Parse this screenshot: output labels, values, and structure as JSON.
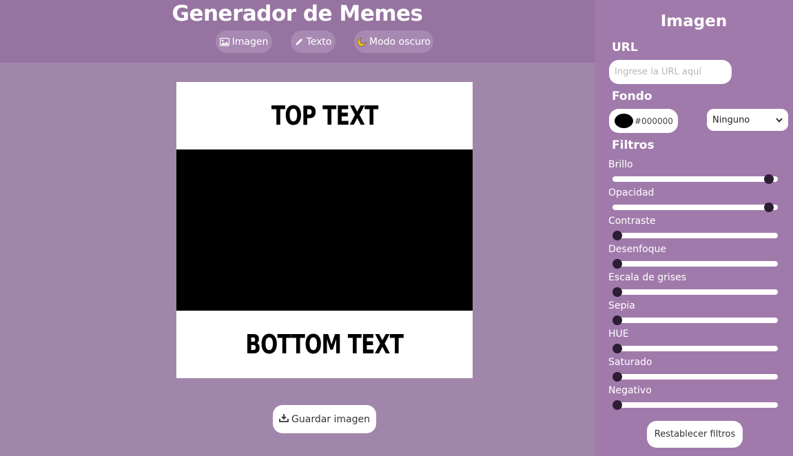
{
  "header": {
    "title": "Generador de Memes",
    "nav": {
      "image_label": "Imagen",
      "text_label": "Texto",
      "dark_mode_label": "Modo oscuro"
    }
  },
  "meme": {
    "top_text": "TOP TEXT",
    "bottom_text": "BOTTOM TEXT",
    "image_background": "#000000"
  },
  "actions": {
    "save_label": "Guardar imagen"
  },
  "panel": {
    "title": "Imagen",
    "url_section": "URL",
    "url_placeholder": "Ingrese la URL aquí",
    "background_section": "Fondo",
    "background_color": "#000000",
    "blend_mode": "Ninguno",
    "filters_section": "Filtros",
    "filters": [
      {
        "label": "Brillo",
        "value": 1
      },
      {
        "label": "Opacidad",
        "value": 1
      },
      {
        "label": "Contraste",
        "value": 0
      },
      {
        "label": "Desenfoque",
        "value": 0
      },
      {
        "label": "Escala de grises",
        "value": 0
      },
      {
        "label": "Sepia",
        "value": 0
      },
      {
        "label": "HUE",
        "value": 0
      },
      {
        "label": "Saturado",
        "value": 0
      },
      {
        "label": "Negativo",
        "value": 0
      }
    ],
    "reset_label": "Restablecer filtros"
  },
  "colors": {
    "header_bg": "#9673a0",
    "page_bg": "#a186ab",
    "panel_bg": "#a07aab",
    "slider_thumb": "#2d1d34"
  }
}
